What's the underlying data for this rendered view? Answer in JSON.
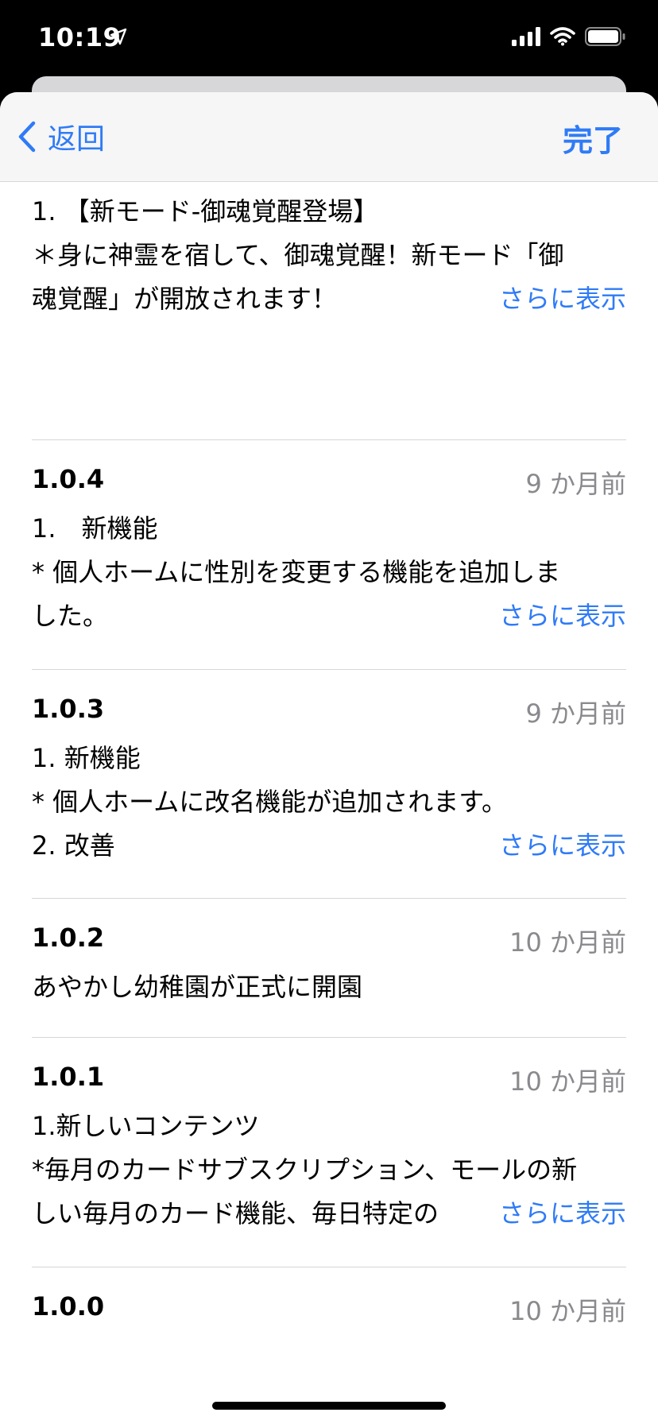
{
  "status_bar": {
    "time": "10:19",
    "icons": [
      "location-arrow-icon",
      "cellular-signal-icon",
      "wifi-icon",
      "battery-icon"
    ]
  },
  "navbar": {
    "back_label": "返回",
    "done_label": "完了"
  },
  "more_label": "さらに表示",
  "top_entry": {
    "lines": [
      "1. 【新モード-御魂覚醒登場】",
      "＊身に神霊を宿して、御魂覚醒！新モード「御",
      "魂覚醒」が開放されます！"
    ]
  },
  "versions": [
    {
      "version": "1.0.4",
      "date": "9 か月前",
      "lines": [
        "1.　新機能",
        "* 個人ホームに性別を変更する機能を追加しま",
        "した。"
      ],
      "has_more": true
    },
    {
      "version": "1.0.3",
      "date": "9 か月前",
      "lines": [
        "1. 新機能",
        "* 個人ホームに改名機能が追加されます。",
        "2. 改善"
      ],
      "has_more": true
    },
    {
      "version": "1.0.2",
      "date": "10 か月前",
      "lines": [
        "あやかし幼稚園が正式に開園"
      ],
      "has_more": false
    },
    {
      "version": "1.0.1",
      "date": "10 か月前",
      "lines": [
        "1.新しいコンテンツ",
        "*毎月のカードサブスクリプション、モールの新",
        "しい毎月のカード機能、毎日特定の"
      ],
      "has_more": true
    },
    {
      "version": "1.0.0",
      "date": "10 か月前",
      "lines": [],
      "has_more": false
    }
  ],
  "colors": {
    "accent": "#2f7bf6",
    "secondary_text": "#8a8a8e",
    "divider": "#d6d6d8",
    "navbar_bg": "#f6f6f6"
  }
}
